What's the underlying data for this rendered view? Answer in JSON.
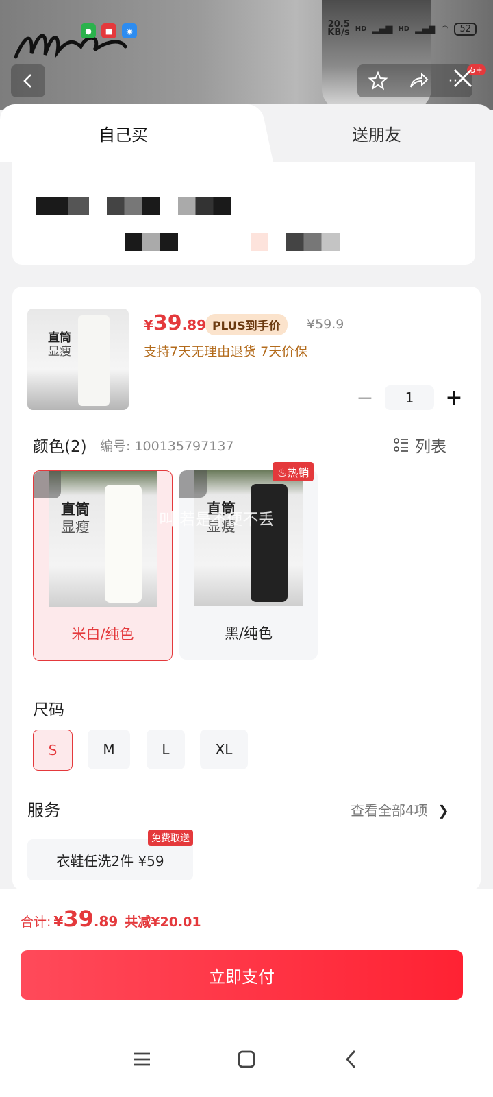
{
  "status_bar": {
    "net_speed_value": "20.5",
    "net_speed_unit": "KB/s",
    "signal_1": "HD",
    "signal_2": "HD",
    "battery": "52",
    "app_icons": [
      "wechat-icon",
      "jd-icon",
      "camera-icon"
    ]
  },
  "header": {
    "notification_count": "5+"
  },
  "tabs": [
    {
      "label": "自己买",
      "active": true
    },
    {
      "label": "送朋友",
      "active": false
    }
  ],
  "product": {
    "price_symbol": "¥",
    "price_int": "39",
    "price_dec": ".89",
    "plus_tag": "PLUS到手价",
    "original_price": "¥59.9",
    "service_note": "支持7天无理由退货 7天价保",
    "quantity": "1",
    "thumb_text_1": "直筒",
    "thumb_text_2": "显瘦"
  },
  "color_section": {
    "title": "颜色(2)",
    "sku": "编号: 100135797137",
    "list_label": "列表",
    "hot_badge": "热销",
    "watermark": "叫,若是不便不丢",
    "options": [
      {
        "label": "米白/纯色",
        "selected": true,
        "img_text_1": "直筒",
        "img_text_2": "显瘦"
      },
      {
        "label": "黑/纯色",
        "selected": false,
        "img_text_1": "直筒",
        "img_text_2": "显瘦"
      }
    ]
  },
  "size_section": {
    "title": "尺码",
    "options": [
      {
        "label": "S",
        "selected": true
      },
      {
        "label": "M",
        "selected": false
      },
      {
        "label": "L",
        "selected": false
      },
      {
        "label": "XL",
        "selected": false
      }
    ]
  },
  "service_section": {
    "title": "服务",
    "view_all": "查看全部4项",
    "chip": "衣鞋任洗2件  ¥59",
    "chip_tag": "免费取送"
  },
  "footer": {
    "total_label": "合计:",
    "total_symbol": "¥",
    "total_int": "39",
    "total_dec": ".89",
    "discount": "共减¥20.01",
    "pay_button": "立即支付"
  },
  "colors": {
    "accent_red": "#e4393c",
    "plus_tag_bg": "#fbe3cc",
    "service_note": "#b36b1c"
  }
}
